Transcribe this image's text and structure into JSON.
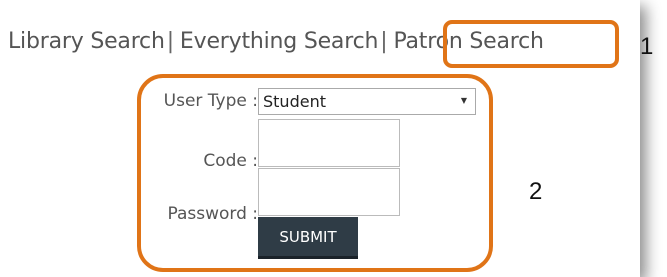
{
  "tabs": {
    "library": "Library Search",
    "everything": "Everything Search",
    "patron": "Patron Search",
    "separator": "|"
  },
  "annotations": {
    "one": "1",
    "two": "2"
  },
  "form": {
    "user_type_label": "User Type :",
    "user_type_value": "Student",
    "code_label": "Code :",
    "password_label": "Password :",
    "submit_label": "SUBMIT"
  },
  "colors": {
    "highlight": "#e07417",
    "button": "#2f3c46"
  }
}
